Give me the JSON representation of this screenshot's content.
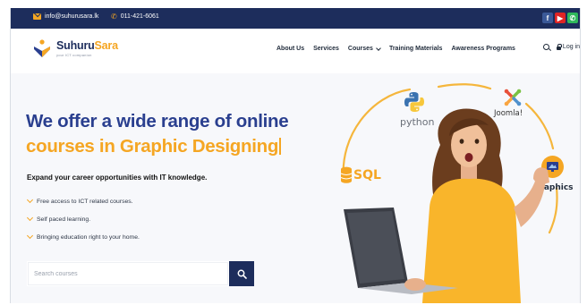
{
  "topbar": {
    "email": "info@suhurusara.lk",
    "phone": "011-421-6061",
    "socials": [
      {
        "name": "facebook",
        "glyph": "f",
        "color": "#3b5998"
      },
      {
        "name": "youtube",
        "glyph": "▶",
        "color": "#e02424"
      },
      {
        "name": "whatsapp",
        "glyph": "✆",
        "color": "#2fb85c"
      }
    ]
  },
  "brand": {
    "name_part1": "Suhuru",
    "name_part2": "Sara",
    "tagline": "your ICT companion"
  },
  "nav": {
    "items": [
      "About Us",
      "Services",
      "Courses",
      "Training Materials",
      "Awareness Programs"
    ],
    "login_label": "Log in"
  },
  "hero": {
    "headline_line1": "We offer a wide range of online",
    "headline_line2": "courses in Graphic Designing",
    "subheadline": "Expand your career opportunities with IT knowledge.",
    "bullets": [
      "Free access to ICT related courses.",
      "Self paced learning.",
      "Bringing education right to your home."
    ],
    "search_placeholder": "Search courses"
  },
  "illustration": {
    "labels": {
      "python": "python",
      "joomla": "Joomla!",
      "sql": "SQL",
      "graphics": "Graphics"
    }
  },
  "colors": {
    "navy": "#1d2d5c",
    "headline_blue": "#2a3f8f",
    "accent_orange": "#f5a623"
  }
}
